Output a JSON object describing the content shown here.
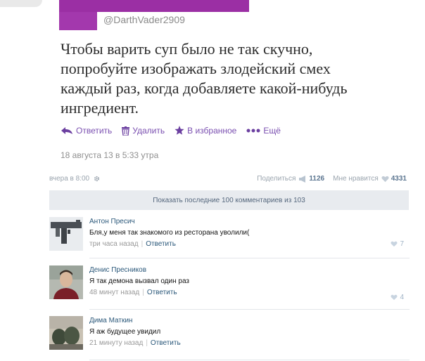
{
  "tweet": {
    "handle": "@DarthVader2909",
    "text": "Чтобы варить суп было не так скучно, попробуйте изображать злодейский смех каждый раз, когда добавляете какой-нибудь ингредиент.",
    "actions": {
      "reply": "Ответить",
      "delete": "Удалить",
      "favorite": "В избранное",
      "more": "Ещё"
    },
    "date": "18 августа 13 в 5:33 утра"
  },
  "post": {
    "date": "вчера в 8:00",
    "share_label": "Поделиться",
    "share_count": "1126",
    "like_label": "Мне нравится",
    "like_count": "4331",
    "show_more": "Показать последние 100 комментариев из 103"
  },
  "comments": [
    {
      "author": "Антон Пресич",
      "text": "Бля,у меня так знакомого из ресторана уволили(",
      "time": "три часа назад",
      "reply": "Ответить",
      "likes": "7",
      "avatar": "gun-avatar"
    },
    {
      "author": "Денис Пресников",
      "text": "Я так демона вызвал один раз",
      "time": "48 минут назад",
      "reply": "Ответить",
      "likes": "4",
      "avatar": "person-avatar"
    },
    {
      "author": "Дима Маткин",
      "text": "Я аж будущее увидил",
      "time": "21 минуту назад",
      "reply": "Ответить",
      "likes": "",
      "avatar": "tree-avatar"
    }
  ],
  "colors": {
    "accent_purple": "#9b2fa4",
    "link_blue": "#2b587a",
    "panel_gray": "#e8ebef"
  }
}
